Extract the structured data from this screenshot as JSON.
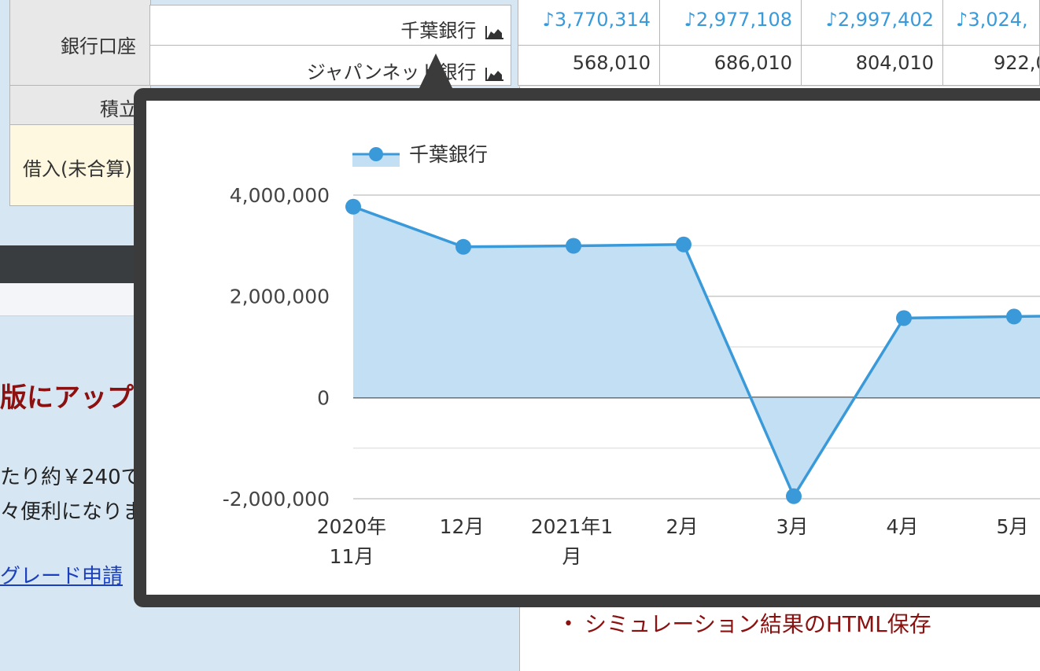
{
  "table": {
    "group_bank_label": "銀行口座",
    "group_saving_label": "積立",
    "group_loan_label": "借入(未合算)",
    "rows": [
      {
        "name": "千葉銀行",
        "values": [
          "♪3,770,314",
          "♪2,977,108",
          "♪2,997,402",
          "♪3,024,"
        ]
      },
      {
        "name": "ジャパンネット銀行",
        "values": [
          "568,010",
          "686,010",
          "804,010",
          "922,0"
        ]
      }
    ]
  },
  "lower_panel": {
    "title": "版にアップ",
    "line1": "たり約￥240で",
    "line2": "々便利になりま",
    "link": "グレード申請",
    "bullet": "シミュレーション結果のHTML保存"
  },
  "colors": {
    "series": "#3a9ad9",
    "fill": "#c2dff3",
    "title_red": "#8b1010",
    "link_blue": "#1a3fbf"
  },
  "chart_data": {
    "type": "area",
    "series": [
      {
        "name": "千葉銀行",
        "values": [
          3770314,
          2977108,
          2997402,
          3024000,
          -1950000,
          1570000,
          1600000
        ]
      }
    ],
    "categories": [
      "2020年\n11月",
      "12月",
      "2021年1\n月",
      "2月",
      "3月",
      "4月",
      "5月"
    ],
    "yticks": [
      "4,000,000",
      "2,000,000",
      "0",
      "-2,000,000"
    ],
    "ylim": [
      -2000000,
      4000000
    ],
    "legend": "top-left",
    "grid": true
  }
}
